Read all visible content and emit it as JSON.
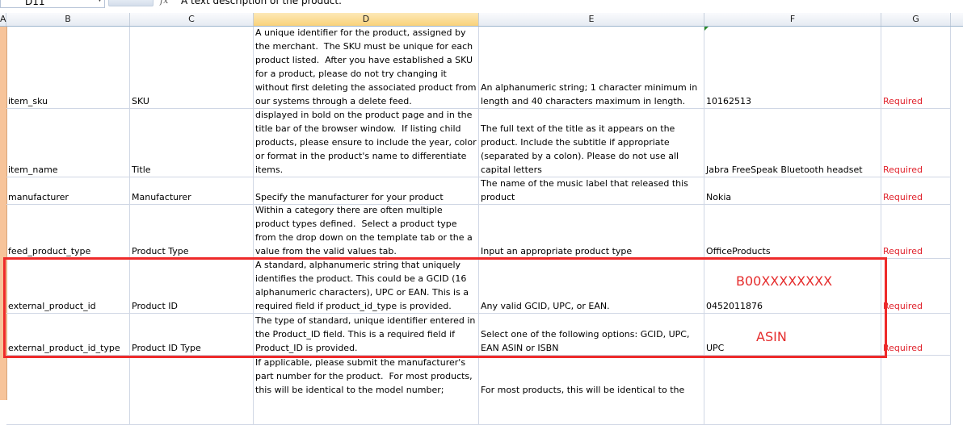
{
  "formula_bar": {
    "name_box": "D11",
    "fx": "fx",
    "formula": "A text description of the product."
  },
  "columns": [
    "A",
    "B",
    "C",
    "D",
    "E",
    "F",
    "G"
  ],
  "rows": [
    {
      "b": "item_sku",
      "c": "SKU",
      "d": "A unique identifier for the product, assigned by the merchant.  The SKU must be unique for each product listed.  After you have established a SKU for a product, please do not try changing it without first deleting the associated product from our systems through a delete feed.",
      "e": "An alphanumeric string; 1 character minimum in length and 40 characters maximum in length.",
      "f": "10162513",
      "g": "Required"
    },
    {
      "b": "item_name",
      "c": "Title",
      "d": "A short title for the product. This will be displayed in bold on the product page and in the title bar of the browser window.  If listing child products, please ensure to include the year, color or format in the product's name to differentiate items.",
      "e": "The full text of the title as it appears on the product. Include the subtitle if appropriate (separated by a colon). Please do not use all capital letters",
      "f": "Jabra FreeSpeak Bluetooth headset",
      "g": "Required"
    },
    {
      "b": "manufacturer",
      "c": "Manufacturer",
      "d": "Specify the manufacturer for your product",
      "e": "The name of the music label that released this product",
      "f": "Nokia",
      "g": "Required"
    },
    {
      "b": "feed_product_type",
      "c": "Product Type",
      "d": "Within a category there are often multiple product types defined.  Select a product type from the drop down on the template tab or the a value from the valid values tab.",
      "e": "Input an appropriate product type",
      "f": "OfficeProducts",
      "g": "Required"
    },
    {
      "b": "external_product_id",
      "c": "Product ID",
      "d": "A standard, alphanumeric string that uniquely identifies the product. This could be a GCID (16 alphanumeric characters), UPC or EAN. This is a required field if product_id_type is provided.",
      "e": "Any valid GCID, UPC, or EAN.",
      "f": "0452011876",
      "g": "Required"
    },
    {
      "b": "external_product_id_type",
      "c": "Product ID Type",
      "d": "The type of standard, unique identifier entered in the Product_ID field. This is a required field if Product_ID is provided.",
      "e": "Select one of the following options: GCID, UPC, EAN ASIN or ISBN",
      "f": "UPC",
      "g": "Required"
    },
    {
      "b": "",
      "c": "",
      "d": "If applicable, please submit the manufacturer's part number for the product.  For most products, this will be identical to the model number;",
      "e": "For most products, this will be identical to the",
      "f": "",
      "g": ""
    }
  ],
  "annotations": {
    "product_id_note": "B00XXXXXXXX",
    "product_id_type_note": "ASIN"
  },
  "colors": {
    "required": "#e0202a",
    "highlight_box": "#ee2a2a",
    "annotation": "#e52d2d"
  }
}
